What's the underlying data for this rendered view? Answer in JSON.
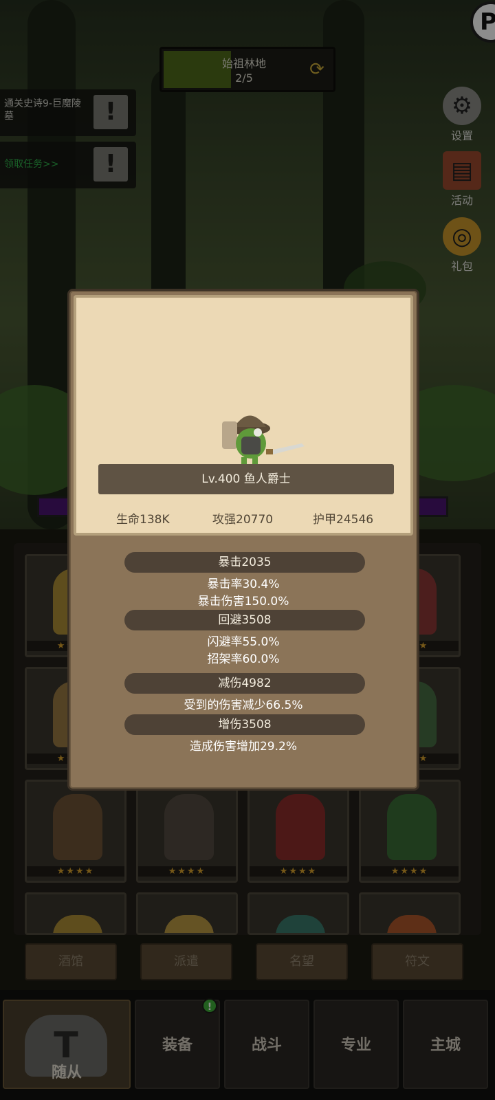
{
  "stage": {
    "name": "始祖林地",
    "progress": "2/5",
    "fill_fraction": 0.4
  },
  "quests": [
    {
      "text": "通关史诗9-巨魔陵墓",
      "alert": "!"
    },
    {
      "text": "领取任务>>",
      "alert": "!"
    }
  ],
  "side_buttons": [
    {
      "label": "设置",
      "icon": "gear-icon"
    },
    {
      "label": "活动",
      "icon": "scroll-icon"
    },
    {
      "label": "礼包",
      "icon": "gift-icon"
    }
  ],
  "corner_logo": "P",
  "popup": {
    "title": "Lv.400 鱼人爵士",
    "stats": {
      "hp": "生命138K",
      "attack": "攻强20770",
      "armor": "护甲24546"
    },
    "groups": [
      {
        "header": "暴击2035",
        "lines": [
          "暴击率30.4%",
          "暴击伤害150.0%"
        ]
      },
      {
        "header": "回避3508",
        "lines": [
          "闪避率55.0%",
          "招架率60.0%"
        ]
      },
      {
        "header": "减伤4982",
        "lines": [
          "受到的伤害减少66.5%"
        ]
      },
      {
        "header": "增伤3508",
        "lines": [
          "造成伤害增加29.2%"
        ]
      }
    ]
  },
  "roster_stars": "★★★★",
  "sub_tabs": [
    "酒馆",
    "派遣",
    "名望",
    "符文"
  ],
  "nav": {
    "active": "随从",
    "items": [
      "装备",
      "战斗",
      "专业",
      "主城"
    ],
    "badge": "!"
  }
}
